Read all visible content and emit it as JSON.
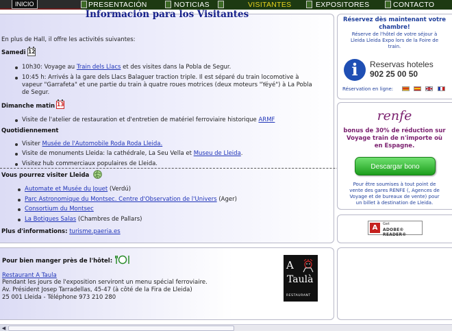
{
  "nav": {
    "inicio": "INICIO",
    "items": [
      "PRESENTACIÓN",
      "NOTICIAS",
      "VISITANTES",
      "EXPOSITORES",
      "CONTACTO"
    ],
    "active_index": 2
  },
  "main": {
    "title": "Información para los Visitantes",
    "intro": "En plus de Hall, il offre les activités suivantes:",
    "saturday": {
      "label": "Samedi",
      "cal_day": "12",
      "item1_pre": "10h30: Voyage au ",
      "item1_link": "Train dels Llacs",
      "item1_post": " et des visites dans la Pobla de Segur.",
      "item2_line1": "10:45 h: Arrivés à la gare dels Llacs Balaguer traction triple. Il est séparé du train locomotive à",
      "item2_line2": "vapeur \"Garrafeta\" et une partie du train à quatre roues motrices (deux moteurs \"Yéyé\") à La Pobla",
      "item2_line3": "de Segur."
    },
    "sunday": {
      "label": "Dimanche matin",
      "cal_day": "13",
      "item1_pre": "Visite de l'atelier de restauration et d'entretien de matériel ferroviaire historique ",
      "item1_link": "ARMF"
    },
    "weekdays": {
      "label": "Quotidiennement",
      "item1_pre": "Visiter ",
      "item1_link": "Musée de l'Automobile Roda Roda Lleida.",
      "item2_pre": "Visite de monuments Lleida: la cathédrale, La Seu Vella et ",
      "item2_link": "Museu de Lleida",
      "item2_post": ".",
      "item3": "Visitez hub commerciaux populaires de Lleida."
    },
    "visit": {
      "label": "Vous pourrez visiter Lleida",
      "items": [
        {
          "link": "Automate et Musée du Jouet",
          "post": " (Verdú)"
        },
        {
          "link": "Parc Astronomique du Montsec. Centre d'Observation de l'Univers",
          "post": " (Ager)"
        },
        {
          "link": "Consortium du Montsec",
          "post": ""
        },
        {
          "link": "La Botigues Salas",
          "post": " (Chambres de Pallars)"
        }
      ]
    },
    "more_info_label": "Plus d'informations:",
    "more_info_link": "turisme.paeria.es"
  },
  "food": {
    "title": "Pour bien manger près de l'hôtel:",
    "restaurant_link": "Restaurant A Taula",
    "line1": "Pendant les jours de l'exposition serviront un menu spécial ferroviaire.",
    "line2": "Av. Président Josep Tarradellas, 45-47 (à côté de la Fira de Lleida)",
    "line3": "25 001 Lleida - Téléphone 973 210 280",
    "logo_line1": "A",
    "logo_line2": "Taulà",
    "logo_line3": "RESTAURANT"
  },
  "side": {
    "reserve_title_1": "Réservez dès maintenant votre",
    "reserve_title_2": "chambre!",
    "reserve_text_1": "Réserve de l'hôtel de votre séjour à",
    "reserve_text_2": "Lleida Lleida Expo lors de la Foire de",
    "reserve_text_3": "train.",
    "info_icon": "i",
    "hotels_label": "Reservas hoteles",
    "hotels_phone": "902 25 00 50",
    "online_label": "Réservation en ligne:",
    "renfe_logo": "renfe",
    "renfe_text_1": "bonus de 30% de réduction sur",
    "renfe_text_2": "Voyage train de n'importe où",
    "renfe_text_3": "en Espagne.",
    "download_button": "Descargar bono",
    "renfe_note_1": "Pour être soumises à tout point de",
    "renfe_note_2": "vente des gares RENFE (, Agences de",
    "renfe_note_3": "Voyage et de bureaux de vente) pour",
    "renfe_note_4": "un billet à destination de Lleida.",
    "adobe_small": "Get",
    "adobe_label": "ADOBE® READER®"
  },
  "colors": {
    "title_blue": "#16208a",
    "link_blue": "#1f34b8",
    "renfe_purple": "#7a1f6e",
    "nav_active": "#e8d21d"
  }
}
